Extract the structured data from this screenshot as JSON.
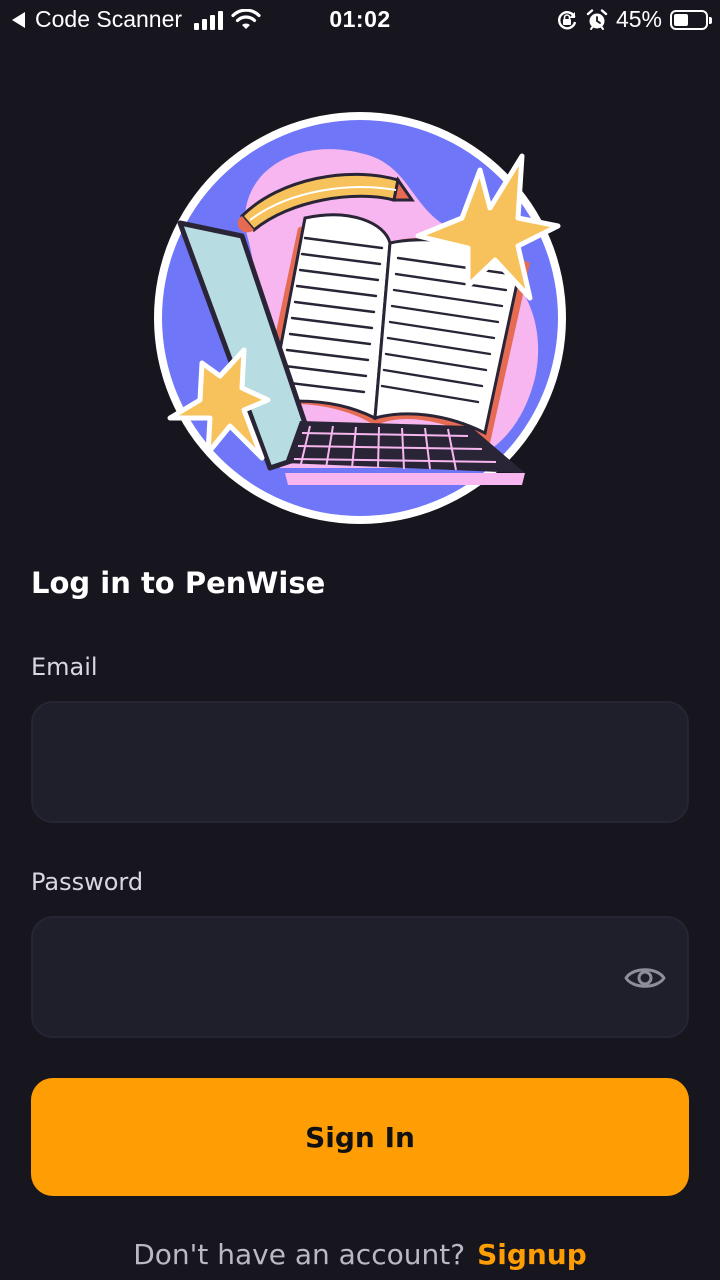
{
  "status_bar": {
    "back_app_label": "Code Scanner",
    "time": "01:02",
    "battery_percent": "45%",
    "battery_level": 0.45
  },
  "login": {
    "title": "Log in to PenWise",
    "email_label": "Email",
    "email_value": "",
    "password_label": "Password",
    "password_value": "",
    "sign_in_label": "Sign In",
    "signup_prompt": "Don't have an account?",
    "signup_link": "Signup"
  },
  "colors": {
    "background": "#17161f",
    "field_background": "#1f1e2b",
    "accent": "#ff9d05"
  },
  "icons": {
    "back": "back-arrow-icon",
    "signal": "cellular-signal-icon",
    "wifi": "wifi-icon",
    "rotation_lock": "rotation-lock-icon",
    "alarm": "alarm-icon",
    "battery": "battery-icon",
    "password_visibility": "eye-icon"
  }
}
